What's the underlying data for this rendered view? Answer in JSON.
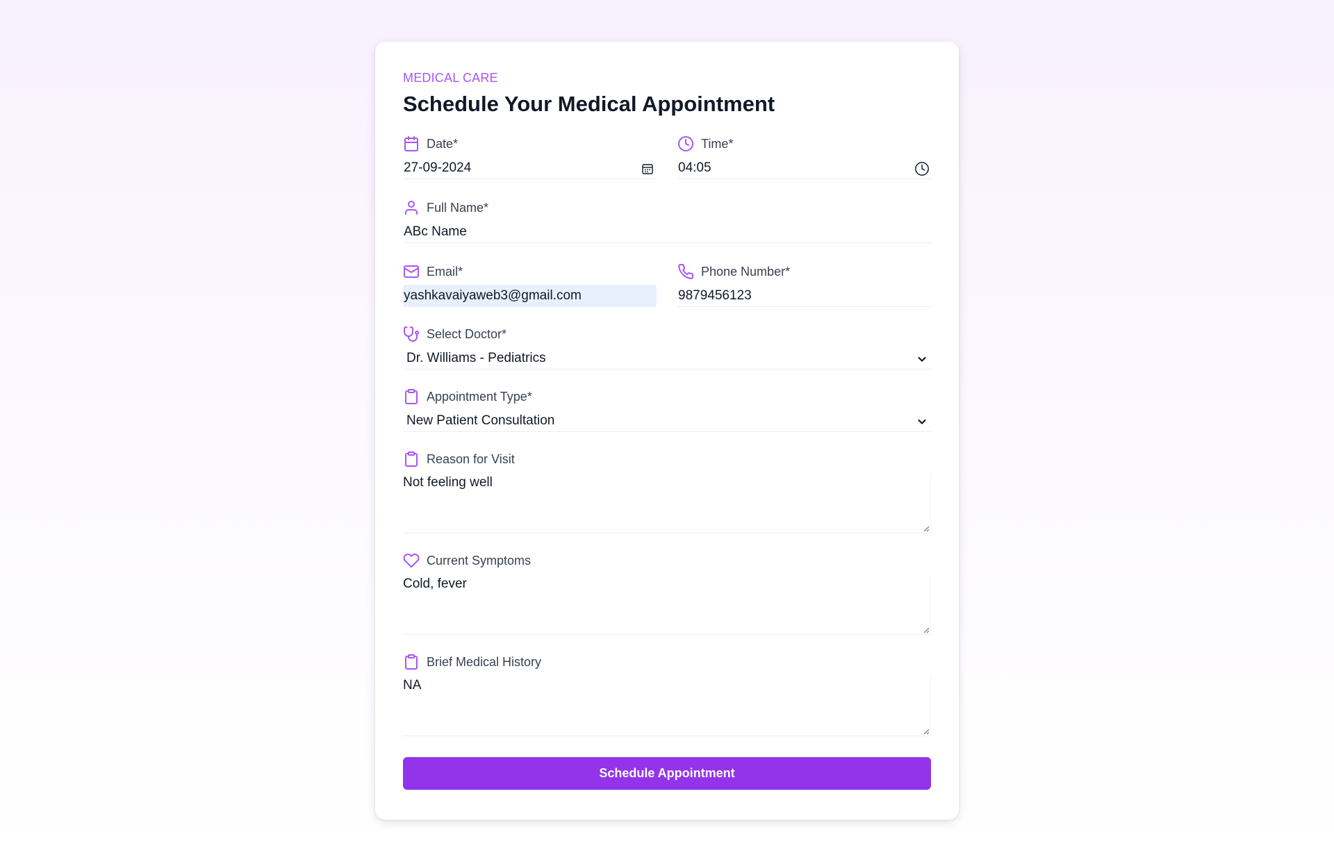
{
  "header": {
    "eyebrow": "MEDICAL CARE",
    "title": "Schedule Your Medical Appointment"
  },
  "form": {
    "date": {
      "label": "Date*",
      "value": "27-09-2024",
      "icon": "calendar-icon",
      "picker_icon": "calendar-picker-icon"
    },
    "time": {
      "label": "Time*",
      "value": "04:05",
      "icon": "clock-icon",
      "picker_icon": "clock-picker-icon"
    },
    "full_name": {
      "label": "Full Name*",
      "value": "ABc Name",
      "icon": "user-icon"
    },
    "email": {
      "label": "Email*",
      "value": "yashkavaiyaweb3@gmail.com",
      "icon": "mail-icon"
    },
    "phone": {
      "label": "Phone Number*",
      "value": "9879456123",
      "icon": "phone-icon"
    },
    "doctor": {
      "label": "Select Doctor*",
      "value": "Dr. Williams - Pediatrics",
      "icon": "stethoscope-icon"
    },
    "appointment_type": {
      "label": "Appointment Type*",
      "value": "New Patient Consultation",
      "icon": "clipboard-icon"
    },
    "reason": {
      "label": "Reason for Visit",
      "value": "Not feeling well",
      "icon": "clipboard-icon"
    },
    "symptoms": {
      "label": "Current Symptoms",
      "value": "Cold, fever",
      "icon": "heart-icon"
    },
    "history": {
      "label": "Brief Medical History",
      "value": "NA",
      "icon": "clipboard-icon"
    },
    "submit_label": "Schedule Appointment"
  },
  "colors": {
    "accent": "#9333ea",
    "accent_light": "#a855f7",
    "autofill_bg": "#e8f0fe",
    "text": "#111827",
    "label": "#374151"
  }
}
